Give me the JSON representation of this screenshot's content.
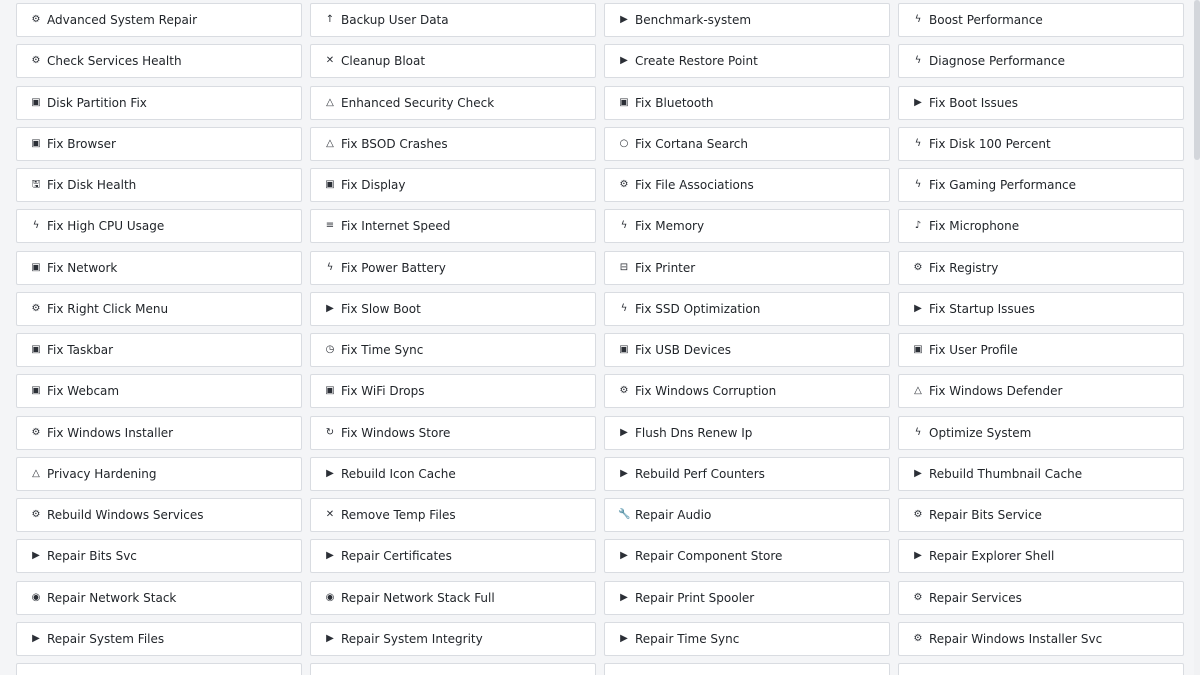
{
  "tools": [
    {
      "label": "Advanced System Repair",
      "icon": "gear-icon",
      "glyph": "⚙"
    },
    {
      "label": "Backup User Data",
      "icon": "arrow-up-icon",
      "glyph": "↑"
    },
    {
      "label": "Benchmark-system",
      "icon": "play-icon",
      "glyph": "▶"
    },
    {
      "label": "Boost Performance",
      "icon": "lightning-icon",
      "glyph": "ϟ"
    },
    {
      "label": "Check Services Health",
      "icon": "gear-icon",
      "glyph": "⚙"
    },
    {
      "label": "Cleanup Bloat",
      "icon": "close-icon",
      "glyph": "✕"
    },
    {
      "label": "Create Restore Point",
      "icon": "play-icon",
      "glyph": "▶"
    },
    {
      "label": "Diagnose Performance",
      "icon": "lightning-icon",
      "glyph": "ϟ"
    },
    {
      "label": "Disk Partition Fix",
      "icon": "window-icon",
      "glyph": "▣"
    },
    {
      "label": "Enhanced Security Check",
      "icon": "warning-triangle-icon",
      "glyph": "△"
    },
    {
      "label": "Fix Bluetooth",
      "icon": "window-icon",
      "glyph": "▣"
    },
    {
      "label": "Fix Boot Issues",
      "icon": "play-icon",
      "glyph": "▶"
    },
    {
      "label": "Fix Browser",
      "icon": "window-icon",
      "glyph": "▣"
    },
    {
      "label": "Fix BSOD Crashes",
      "icon": "warning-triangle-icon",
      "glyph": "△"
    },
    {
      "label": "Fix Cortana Search",
      "icon": "circle-icon",
      "glyph": "○"
    },
    {
      "label": "Fix Disk 100 Percent",
      "icon": "lightning-icon",
      "glyph": "ϟ"
    },
    {
      "label": "Fix Disk Health",
      "icon": "disk-icon",
      "glyph": "🖫"
    },
    {
      "label": "Fix Display",
      "icon": "window-icon",
      "glyph": "▣"
    },
    {
      "label": "Fix File Associations",
      "icon": "gear-icon",
      "glyph": "⚙"
    },
    {
      "label": "Fix Gaming Performance",
      "icon": "lightning-icon",
      "glyph": "ϟ"
    },
    {
      "label": "Fix High CPU Usage",
      "icon": "lightning-icon",
      "glyph": "ϟ"
    },
    {
      "label": "Fix Internet Speed",
      "icon": "list-icon",
      "glyph": "≡"
    },
    {
      "label": "Fix Memory",
      "icon": "lightning-icon",
      "glyph": "ϟ"
    },
    {
      "label": "Fix Microphone",
      "icon": "music-note-icon",
      "glyph": "♪"
    },
    {
      "label": "Fix Network",
      "icon": "window-icon",
      "glyph": "▣"
    },
    {
      "label": "Fix Power Battery",
      "icon": "lightning-icon",
      "glyph": "ϟ"
    },
    {
      "label": "Fix Printer",
      "icon": "printer-icon",
      "glyph": "⊟"
    },
    {
      "label": "Fix Registry",
      "icon": "gear-icon",
      "glyph": "⚙"
    },
    {
      "label": "Fix Right Click Menu",
      "icon": "gear-icon",
      "glyph": "⚙"
    },
    {
      "label": "Fix Slow Boot",
      "icon": "play-icon",
      "glyph": "▶"
    },
    {
      "label": "Fix SSD Optimization",
      "icon": "lightning-icon",
      "glyph": "ϟ"
    },
    {
      "label": "Fix Startup Issues",
      "icon": "play-icon",
      "glyph": "▶"
    },
    {
      "label": "Fix Taskbar",
      "icon": "window-icon",
      "glyph": "▣"
    },
    {
      "label": "Fix Time Sync",
      "icon": "clock-icon",
      "glyph": "◷"
    },
    {
      "label": "Fix USB Devices",
      "icon": "window-icon",
      "glyph": "▣"
    },
    {
      "label": "Fix User Profile",
      "icon": "window-icon",
      "glyph": "▣"
    },
    {
      "label": "Fix Webcam",
      "icon": "window-icon",
      "glyph": "▣"
    },
    {
      "label": "Fix WiFi Drops",
      "icon": "window-icon",
      "glyph": "▣"
    },
    {
      "label": "Fix Windows Corruption",
      "icon": "gear-icon",
      "glyph": "⚙"
    },
    {
      "label": "Fix Windows Defender",
      "icon": "warning-triangle-icon",
      "glyph": "△"
    },
    {
      "label": "Fix Windows Installer",
      "icon": "gear-icon",
      "glyph": "⚙"
    },
    {
      "label": "Fix Windows Store",
      "icon": "refresh-icon",
      "glyph": "↻"
    },
    {
      "label": "Flush Dns Renew Ip",
      "icon": "play-icon",
      "glyph": "▶"
    },
    {
      "label": "Optimize System",
      "icon": "lightning-icon",
      "glyph": "ϟ"
    },
    {
      "label": "Privacy Hardening",
      "icon": "warning-triangle-icon",
      "glyph": "△"
    },
    {
      "label": "Rebuild Icon Cache",
      "icon": "play-icon",
      "glyph": "▶"
    },
    {
      "label": "Rebuild Perf Counters",
      "icon": "play-icon",
      "glyph": "▶"
    },
    {
      "label": "Rebuild Thumbnail Cache",
      "icon": "play-icon",
      "glyph": "▶"
    },
    {
      "label": "Rebuild Windows Services",
      "icon": "gear-icon",
      "glyph": "⚙"
    },
    {
      "label": "Remove Temp Files",
      "icon": "close-icon",
      "glyph": "✕"
    },
    {
      "label": "Repair Audio",
      "icon": "wrench-icon",
      "glyph": "🔧"
    },
    {
      "label": "Repair Bits Service",
      "icon": "gear-icon",
      "glyph": "⚙"
    },
    {
      "label": "Repair Bits Svc",
      "icon": "play-icon",
      "glyph": "▶"
    },
    {
      "label": "Repair Certificates",
      "icon": "play-icon",
      "glyph": "▶"
    },
    {
      "label": "Repair Component Store",
      "icon": "play-icon",
      "glyph": "▶"
    },
    {
      "label": "Repair Explorer Shell",
      "icon": "play-icon",
      "glyph": "▶"
    },
    {
      "label": "Repair Network Stack",
      "icon": "globe-icon",
      "glyph": "◉"
    },
    {
      "label": "Repair Network Stack Full",
      "icon": "globe-icon",
      "glyph": "◉"
    },
    {
      "label": "Repair Print Spooler",
      "icon": "play-icon",
      "glyph": "▶"
    },
    {
      "label": "Repair Services",
      "icon": "gear-icon",
      "glyph": "⚙"
    },
    {
      "label": "Repair System Files",
      "icon": "play-icon",
      "glyph": "▶"
    },
    {
      "label": "Repair System Integrity",
      "icon": "play-icon",
      "glyph": "▶"
    },
    {
      "label": "Repair Time Sync",
      "icon": "play-icon",
      "glyph": "▶"
    },
    {
      "label": "Repair Windows Installer Svc",
      "icon": "gear-icon",
      "glyph": "⚙"
    },
    {
      "label": "",
      "icon": "",
      "glyph": ""
    },
    {
      "label": "",
      "icon": "",
      "glyph": ""
    },
    {
      "label": "",
      "icon": "",
      "glyph": ""
    },
    {
      "label": "",
      "icon": "",
      "glyph": ""
    }
  ]
}
